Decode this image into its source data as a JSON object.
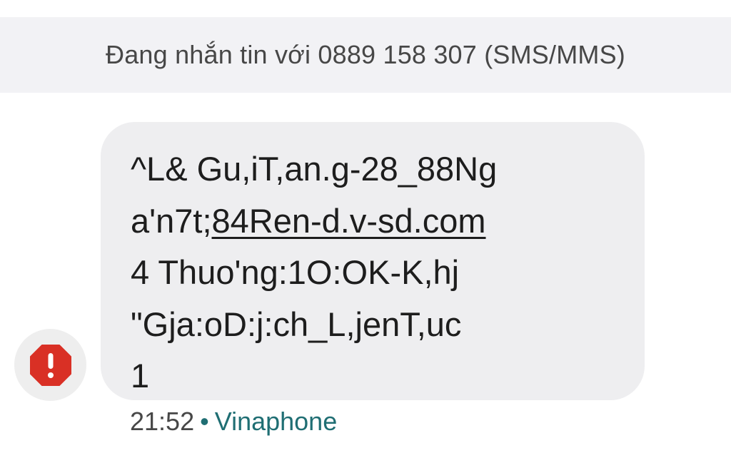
{
  "header": {
    "conversation_label": "Đang nhắn tin với 0889 158 307 (SMS/MMS)"
  },
  "sender": {
    "avatar_icon": "warning-octagon-icon",
    "avatar_color": "#d93025"
  },
  "message": {
    "line1": "^L& Gu,iT,an.g-28_88Ng",
    "line2_prefix": "a'n7t;",
    "line2_link": "84Ren-d.v-sd.com",
    "line3": "4 Thuo'ng:1O:OK-K,hj",
    "line4": "\"Gja:oD:j:ch_L,jenT,uc",
    "line5": "1"
  },
  "meta": {
    "time": "21:52",
    "separator": "•",
    "carrier": "Vinaphone",
    "carrier_color": "#1f6e73"
  }
}
